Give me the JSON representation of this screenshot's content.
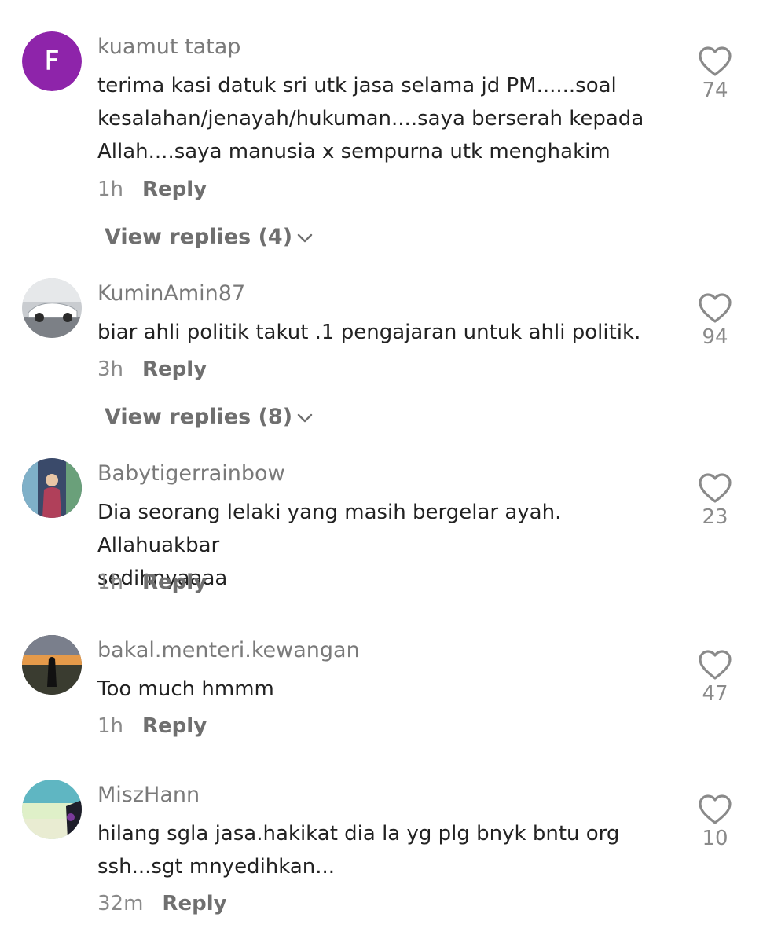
{
  "comments": [
    {
      "username": "kuamut tatap",
      "avatar_letter": "F",
      "avatar_color": "#8e24aa",
      "text": "terima kasi datuk sri utk jasa selama jd PM......soal\nkesalahan/jenayah/hukuman....saya berserah kepada\nAllah....saya manusia x sempurna utk menghakim",
      "time": "1h",
      "reply_label": "Reply",
      "likes": "74",
      "view_replies": "View replies (4)"
    },
    {
      "username": "KuminAmin87",
      "avatar_desc": "white-sports-car-photo",
      "text": "biar ahli politik takut .1 pengajaran untuk ahli politik.",
      "time": "3h",
      "reply_label": "Reply",
      "likes": "94",
      "view_replies": "View replies (8)"
    },
    {
      "username": "Babytigerrainbow",
      "avatar_desc": "person-photo",
      "text": "Dia seorang lelaki yang masih bergelar ayah. Allahuakbar\nsedihnyaaaa",
      "time": "1h",
      "reply_label": "Reply",
      "likes": "23"
    },
    {
      "username": "bakal.menteri.kewangan",
      "avatar_desc": "sunset-silhouette-photo",
      "text": "Too much hmmm",
      "time": "1h",
      "reply_label": "Reply",
      "likes": "47"
    },
    {
      "username": "MiszHann",
      "avatar_desc": "landscape-photo",
      "text": "hilang sgla jasa.hakikat dia la yg plg bnyk bntu org\nssh...sgt mnyedihkan...",
      "time": "32m",
      "reply_label": "Reply",
      "likes": "10"
    }
  ],
  "icons": {
    "like": "heart-outline-icon",
    "expand": "chevron-down-icon"
  },
  "colors": {
    "username": "#7a7a7a",
    "text": "#222222",
    "meta": "#8a8a8a",
    "accent_avatar": "#8e24aa"
  }
}
